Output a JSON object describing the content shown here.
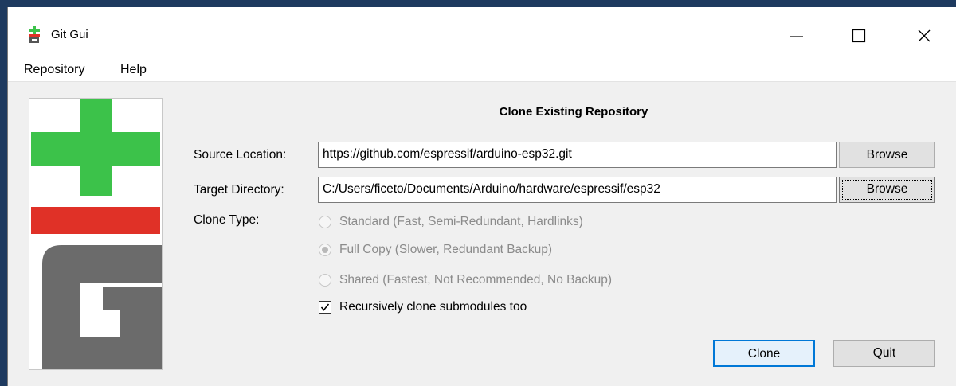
{
  "window": {
    "title": "Git Gui",
    "controls": {
      "minimize": "minimize-icon",
      "maximize": "maximize-icon",
      "close": "close-icon"
    }
  },
  "menubar": {
    "items": [
      "Repository",
      "Help"
    ]
  },
  "dialog": {
    "heading": "Clone Existing Repository",
    "source": {
      "label": "Source Location:",
      "value": "https://github.com/espressif/arduino-esp32.git",
      "browse": "Browse"
    },
    "target": {
      "label": "Target Directory:",
      "value": "C:/Users/ficeto/Documents/Arduino/hardware/espressif/esp32",
      "browse": "Browse"
    },
    "clone_type": {
      "label": "Clone Type:",
      "options": [
        "Standard (Fast, Semi-Redundant, Hardlinks)",
        "Full Copy (Slower, Redundant Backup)",
        "Shared (Fastest, Not Recommended, No Backup)"
      ],
      "selected_index": 1,
      "enabled": false
    },
    "recursive": {
      "label": "Recursively clone submodules too",
      "checked": true
    },
    "buttons": {
      "clone": "Clone",
      "quit": "Quit"
    }
  },
  "colors": {
    "git_green": "#3cc24a",
    "git_red": "#e03127",
    "git_gray": "#6b6b6b",
    "focus_blue": "#0078d7"
  }
}
